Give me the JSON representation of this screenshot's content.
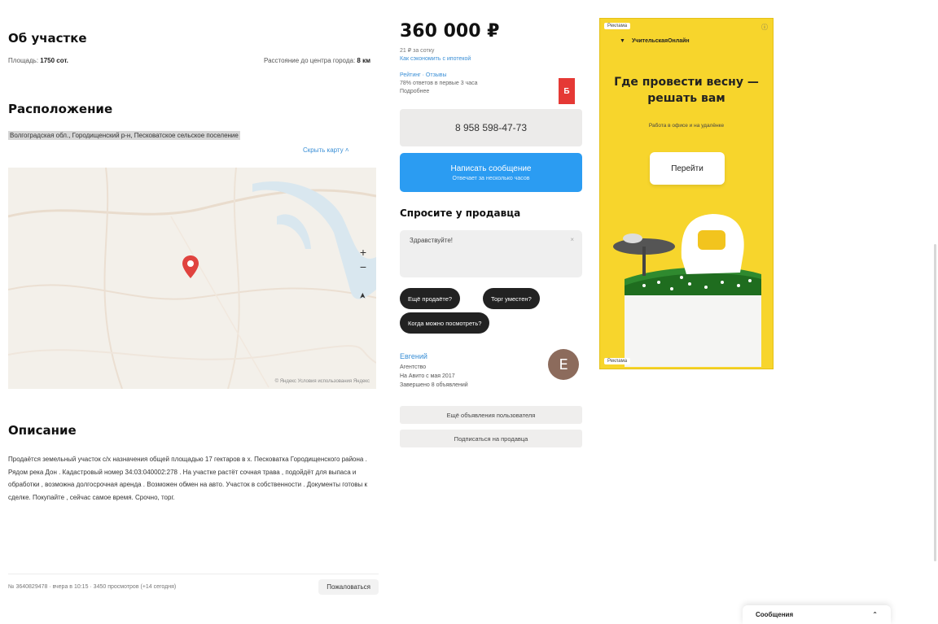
{
  "about": {
    "title": "Об участке",
    "area_label": "Площадь:",
    "area_value": "1750 сот.",
    "distance_label": "Расстояние до центра города:",
    "distance_value": "8 км"
  },
  "location": {
    "title": "Расположение",
    "address": "Волгоградская обл., Городищенский р-н, Песковатское сельское поселение",
    "map_link": "Скрыть карту",
    "map_footer": "© Яндекс  Условия использования  Яндекс",
    "zoom_in": "+",
    "zoom_out": "−",
    "locate": "➤"
  },
  "description": {
    "title": "Описание",
    "text": "Продаётся земельный участок с/х назначения общей площадью 17 гектаров в х. Песковатка Городищенского района . Рядом река Дон . Кадастровый номер 34:03:040002:278 . На участке растёт сочная трава , подойдёт для выпаса и обработки , возможна долгосрочная аренда . Возможен обмен на авто. Участок в собственности . Документы готовы к сделке. Покупайте , сейчас самое время. Срочно, торг."
  },
  "listing_footer": {
    "meta": "№ 3640829478 · вчера в 10:15 · 3450 просмотров (+14 сегодня)",
    "complain": "Пожаловаться"
  },
  "price": {
    "value": "360 000 ₽",
    "per_unit": "21 ₽ за сотку",
    "mortgage_link": "Как сэкономить с ипотекой"
  },
  "seller_stats": {
    "line1": "Рейтинг · Отзывы",
    "line2": "78% ответов в первые 3 часа",
    "line3": "Подробнее"
  },
  "badge": "Б",
  "phone": "8 958 598-47-73",
  "message_button": {
    "label": "Написать сообщение",
    "sub": "Отвечает за несколько часов"
  },
  "ask": {
    "title": "Спросите у продавца",
    "placeholder": "Здравствуйте!",
    "close": "×",
    "chips": [
      "Ещё продаёте?",
      "Торг уместен?",
      "Когда можно посмотреть?"
    ]
  },
  "seller": {
    "name": "Евгений",
    "type": "Агентство",
    "since": "На Авито с мая 2017",
    "completed": "Завершено 8 объявлений",
    "avatar_letter": "Е",
    "other_ads": "Ещё объявления пользователя",
    "subscribe": "Подписаться на продавца"
  },
  "ad": {
    "label": "Реклама",
    "info": "ⓘ",
    "brand": "УчительскаяОнлайн",
    "title": "Где провести весну — решать вам",
    "subtitle": "Работа в офисе и на удалёнке",
    "button": "Перейти",
    "footer_label": "Реклама"
  },
  "messages_bar": {
    "label": "Сообщения",
    "chevron": "⌃"
  },
  "colors": {
    "primary_blue": "#2b9cf2",
    "ad_yellow": "#f7d52c",
    "badge_red": "#e53935",
    "pin_red": "#e0433f"
  }
}
